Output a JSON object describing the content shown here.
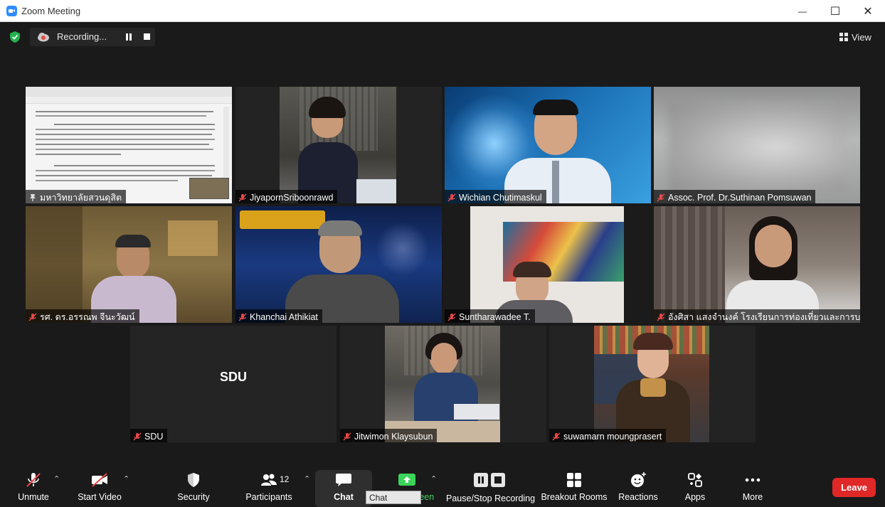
{
  "window": {
    "title": "Zoom Meeting",
    "minimize_glyph": "—",
    "maximize_glyph": "☐",
    "close_glyph": "✕"
  },
  "top_bar": {
    "recording_label": "Recording...",
    "view_label": "View"
  },
  "participants": [
    {
      "id": "screen-share",
      "name": "มหาวิทยาลัยสวนดุสิต",
      "active_speaker": true
    },
    {
      "id": "jiyaporn",
      "name": "JiyapornSriboonrawd"
    },
    {
      "id": "wichian",
      "name": "Wichian Chutimaskul"
    },
    {
      "id": "suthinan",
      "name": "Assoc. Prof. Dr.Suthinan Pomsuwan"
    },
    {
      "id": "ornanong",
      "name": "รศ. ดร.อรรณพ จีนะวัฒน์"
    },
    {
      "id": "khanchai",
      "name": "Khanchai Athikiat"
    },
    {
      "id": "suntharawadee",
      "name": "Suntharawadee T."
    },
    {
      "id": "angsisa",
      "name": "อังศิสา แสงจำนงค์ โรงเรียนการท่องเที่ยวและการบริ..."
    },
    {
      "id": "sdu",
      "name": "SDU",
      "display_text": "SDU"
    },
    {
      "id": "jitwimon",
      "name": "Jitwimon Klaysubun"
    },
    {
      "id": "suwamarn",
      "name": "suwamarn moungprasert"
    }
  ],
  "toolbar": {
    "unmute": "Unmute",
    "start_video": "Start Video",
    "security": "Security",
    "participants": "Participants",
    "participant_count": "12",
    "chat": "Chat",
    "share_screen": "Share Screen",
    "pause_stop_recording": "Pause/Stop Recording",
    "breakout_rooms": "Breakout Rooms",
    "reactions": "Reactions",
    "apps": "Apps",
    "more": "More",
    "leave": "Leave",
    "tooltip": "Chat"
  },
  "colors": {
    "accent_green": "#3bd45a",
    "leave_red": "#e02828",
    "active_outline": "#e9e94a",
    "mic_off_red": "#e64848"
  }
}
